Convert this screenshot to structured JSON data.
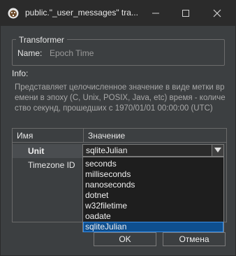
{
  "window": {
    "title": "public.\"_user_messages\" tra...",
    "icons": {
      "app": "dbeaver-beaver-icon",
      "minimize": "minimize-icon",
      "maximize": "maximize-icon",
      "close": "close-icon"
    }
  },
  "transformer": {
    "legend": "Transformer",
    "name_label": "Name:",
    "name_value": "Epoch Time"
  },
  "info": {
    "label": "Info:",
    "text": "Представляет целочисленное значение в виде метки времени в эпоху (C, Unix, POSIX, Java, etc) время - количество секунд, прошедших с 1970/01/01 00:00:00 (UTC)"
  },
  "properties_table": {
    "columns": [
      "Имя",
      "Значение"
    ],
    "rows": [
      {
        "name": "Unit",
        "value": "sqliteJulian"
      },
      {
        "name": "Timezone ID",
        "value": ""
      }
    ]
  },
  "unit_dropdown": {
    "selected": "sqliteJulian",
    "options": [
      "seconds",
      "milliseconds",
      "nanoseconds",
      "dotnet",
      "w32filetime",
      "oadate",
      "sqliteJulian"
    ],
    "highlighted_index": 6
  },
  "buttons": {
    "ok": "OK",
    "cancel": "Отмена"
  }
}
